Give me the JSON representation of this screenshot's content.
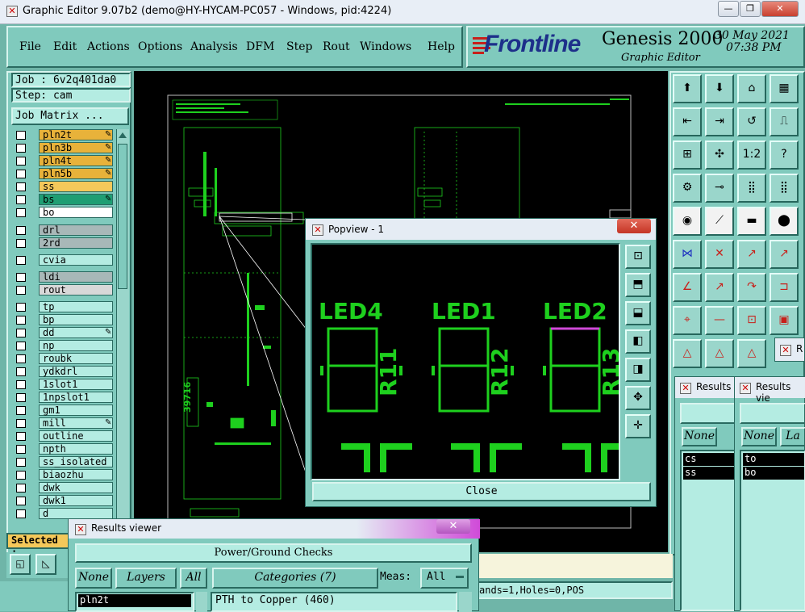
{
  "window": {
    "title": "Graphic Editor 9.07b2 (demo@HY-HYCAM-PC057 - Windows, pid:4224)"
  },
  "caption_buttons": {
    "minimize": "—",
    "restore": "❐",
    "close": "✕"
  },
  "menu": [
    "File",
    "Edit",
    "Actions",
    "Options",
    "Analysis",
    "DFM",
    "Step",
    "Rout",
    "Windows",
    "Help"
  ],
  "brand": {
    "logo": "Frontline",
    "product": "Genesis 2000",
    "subtitle": "Graphic Editor",
    "date": "30 May 2021",
    "time": "07:38 PM"
  },
  "job": {
    "job_label": "Job : 6v2q401da0",
    "step_label": "Step: cam",
    "matrix_button": "Job Matrix ..."
  },
  "layers": [
    {
      "name": "pln2t",
      "color": "#e8b23a",
      "mark": true
    },
    {
      "name": "pln3b",
      "color": "#e8b23a",
      "mark": true
    },
    {
      "name": "pln4t",
      "color": "#e8b23a",
      "mark": true
    },
    {
      "name": "pln5b",
      "color": "#e8b23a",
      "mark": true
    },
    {
      "name": "ss",
      "color": "#f4c85a",
      "mark": false
    },
    {
      "name": "bs",
      "color": "#1f9e73",
      "mark": true
    },
    {
      "name": "bo",
      "color": "#ffffff",
      "mark": false
    },
    {
      "name": "drl",
      "color": "#a8b8b8",
      "mark": false
    },
    {
      "name": "2rd",
      "color": "#a8b8b8",
      "mark": false
    },
    {
      "name": "cvia",
      "color": "#b4ece2",
      "mark": false
    },
    {
      "name": "ldi",
      "color": "#a8b8b8",
      "mark": false
    },
    {
      "name": "rout",
      "color": "#d8d8d8",
      "mark": false
    },
    {
      "name": "tp",
      "color": "#b4ece2",
      "mark": false
    },
    {
      "name": "bp",
      "color": "#b4ece2",
      "mark": false
    },
    {
      "name": "dd",
      "color": "#b4ece2",
      "mark": true
    },
    {
      "name": "np",
      "color": "#b4ece2",
      "mark": false
    },
    {
      "name": "roubk",
      "color": "#b4ece2",
      "mark": false
    },
    {
      "name": "ydkdrl",
      "color": "#b4ece2",
      "mark": false
    },
    {
      "name": "1slot1",
      "color": "#b4ece2",
      "mark": false
    },
    {
      "name": "1npslot1",
      "color": "#b4ece2",
      "mark": false
    },
    {
      "name": "gm1",
      "color": "#b4ece2",
      "mark": false
    },
    {
      "name": "mill",
      "color": "#b4ece2",
      "mark": true
    },
    {
      "name": "outline",
      "color": "#b4ece2",
      "mark": false
    },
    {
      "name": "npth",
      "color": "#b4ece2",
      "mark": false
    },
    {
      "name": "ss_isolated",
      "color": "#b4ece2",
      "mark": false
    },
    {
      "name": "biaozhu",
      "color": "#b4ece2",
      "mark": false
    },
    {
      "name": "dwk",
      "color": "#b4ece2",
      "mark": false
    },
    {
      "name": "dwk1",
      "color": "#b4ece2",
      "mark": false
    },
    {
      "name": "d",
      "color": "#b4ece2",
      "mark": false
    }
  ],
  "selected_label": "Selected :",
  "popview": {
    "title": "Popview - 1",
    "leds": [
      "LED4",
      "LED1",
      "LED2"
    ],
    "refs": [
      "R11",
      "R12",
      "R13"
    ],
    "close_label": "Close"
  },
  "results_viewer": {
    "title": "Results viewer",
    "header": "Power/Ground Checks",
    "none_label": "None",
    "layers_label": "Layers",
    "all_label": "All",
    "categories_label": "Categories (7)",
    "meas_label": "Meas:",
    "meas_value": "All",
    "layer_item": "pln2t",
    "category_item": "PTH to Copper (460)"
  },
  "status": {
    "text": "ands=1,Holes=0,POS"
  },
  "side_viewers": [
    {
      "title": "Results",
      "none_label": "None",
      "items": [
        "cs",
        "ss"
      ]
    },
    {
      "title": "Results vie",
      "none_label": "None",
      "extra": "La",
      "items": [
        "to",
        "bo"
      ]
    }
  ],
  "colors": {
    "canvas_bg": "#000000",
    "pcb_line": "#1ed01e",
    "panel": "#80cabd",
    "highlight": "#d04ad8"
  }
}
